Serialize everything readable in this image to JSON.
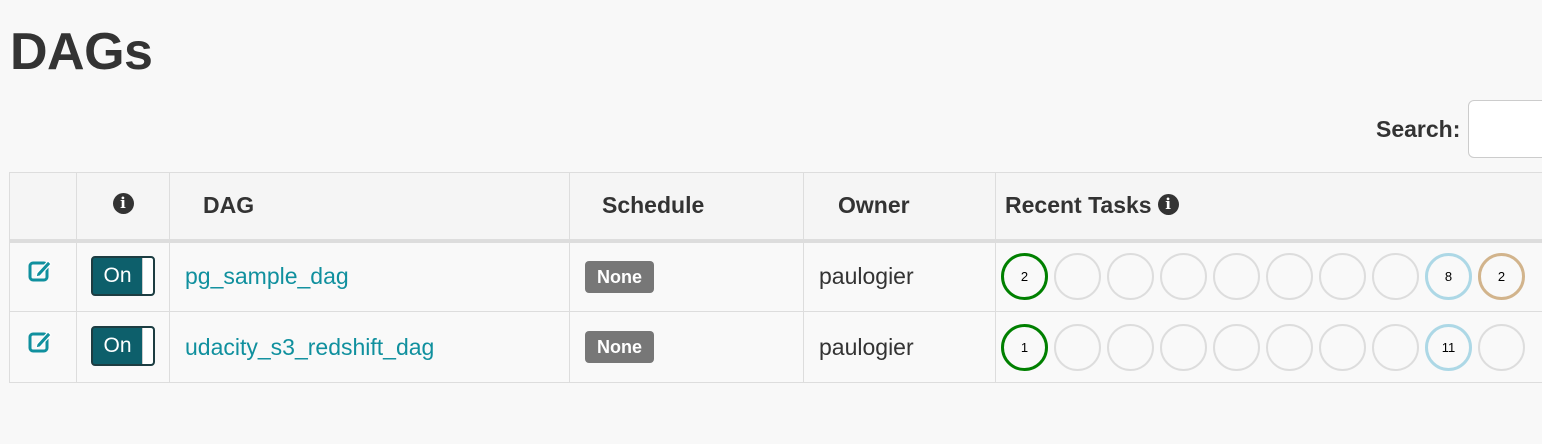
{
  "page": {
    "title": "DAGs"
  },
  "search": {
    "label": "Search:",
    "value": "",
    "placeholder": ""
  },
  "table": {
    "columns": {
      "edit": "",
      "info_icon": "info-icon",
      "dag": "DAG",
      "schedule": "Schedule",
      "owner": "Owner",
      "recent_tasks": "Recent Tasks"
    },
    "rows": [
      {
        "toggle": "On",
        "dag_id": "pg_sample_dag",
        "schedule": "None",
        "owner": "paulogier",
        "recent_tasks": [
          {
            "count": "2",
            "color": "#008000",
            "state": "success"
          },
          {
            "count": "",
            "color": "#dddddd",
            "state": "empty"
          },
          {
            "count": "",
            "color": "#dddddd",
            "state": "empty"
          },
          {
            "count": "",
            "color": "#dddddd",
            "state": "empty"
          },
          {
            "count": "",
            "color": "#dddddd",
            "state": "empty"
          },
          {
            "count": "",
            "color": "#dddddd",
            "state": "empty"
          },
          {
            "count": "",
            "color": "#dddddd",
            "state": "empty"
          },
          {
            "count": "",
            "color": "#dddddd",
            "state": "empty"
          },
          {
            "count": "8",
            "color": "#add8e6",
            "state": "skipped"
          },
          {
            "count": "2",
            "color": "#d2b48c",
            "state": "shutdown"
          }
        ]
      },
      {
        "toggle": "On",
        "dag_id": "udacity_s3_redshift_dag",
        "schedule": "None",
        "owner": "paulogier",
        "recent_tasks": [
          {
            "count": "1",
            "color": "#008000",
            "state": "success"
          },
          {
            "count": "",
            "color": "#dddddd",
            "state": "empty"
          },
          {
            "count": "",
            "color": "#dddddd",
            "state": "empty"
          },
          {
            "count": "",
            "color": "#dddddd",
            "state": "empty"
          },
          {
            "count": "",
            "color": "#dddddd",
            "state": "empty"
          },
          {
            "count": "",
            "color": "#dddddd",
            "state": "empty"
          },
          {
            "count": "",
            "color": "#dddddd",
            "state": "empty"
          },
          {
            "count": "",
            "color": "#dddddd",
            "state": "empty"
          },
          {
            "count": "11",
            "color": "#add8e6",
            "state": "skipped"
          },
          {
            "count": "",
            "color": "#dddddd",
            "state": "empty"
          }
        ]
      }
    ]
  },
  "colors": {
    "link": "#10909e",
    "toggle_bg": "#0d5f6b",
    "badge_bg": "#777777",
    "edit_icon": "#10909e"
  }
}
